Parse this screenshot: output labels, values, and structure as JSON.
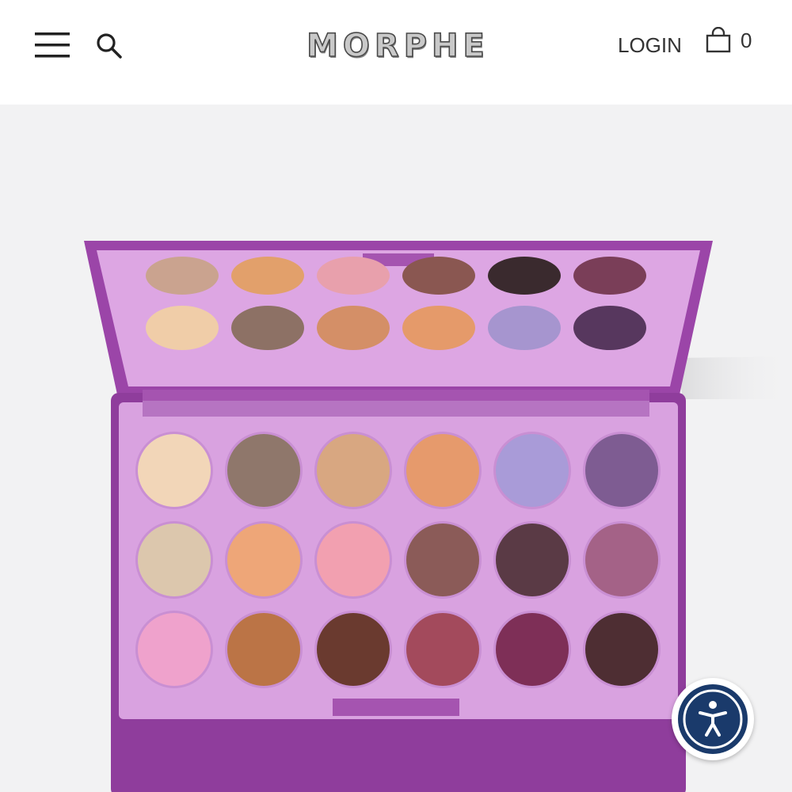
{
  "header": {
    "brand": "MORPHE",
    "login_label": "LOGIN",
    "cart_count": "0",
    "icons": {
      "menu": "hamburger-menu-icon",
      "search": "search-icon",
      "cart": "shopping-bag-icon"
    }
  },
  "product_image": {
    "palette": {
      "case_color": "#9b45a8",
      "tray_color": "#d9a2e0",
      "mirror_shades": [
        [
          "#caa38f",
          "#e2a06b",
          "#e8a0ac",
          "#8a5751",
          "#3a2a2e",
          "#7a3e58"
        ],
        [
          "#f0cda8",
          "#8d7165",
          "#d48f67",
          "#e59a6a",
          "#a695cf",
          "#57375e"
        ]
      ],
      "tray_shades": [
        [
          "#f2d6b8",
          "#8f776b",
          "#d8a781",
          "#e69a6c",
          "#a99bd8",
          "#7e5c92"
        ],
        [
          "#dcc7ad",
          "#eea678",
          "#f2a0b0",
          "#8b5b58",
          "#5a3a45",
          "#a46287"
        ],
        [
          "#efa2cc",
          "#bb7446",
          "#6a3a2f",
          "#a34a5c",
          "#7e2f57",
          "#4e2e33"
        ]
      ]
    }
  },
  "accessibility": {
    "icon": "accessibility-person-icon",
    "ring_color": "#1a3a6b"
  }
}
